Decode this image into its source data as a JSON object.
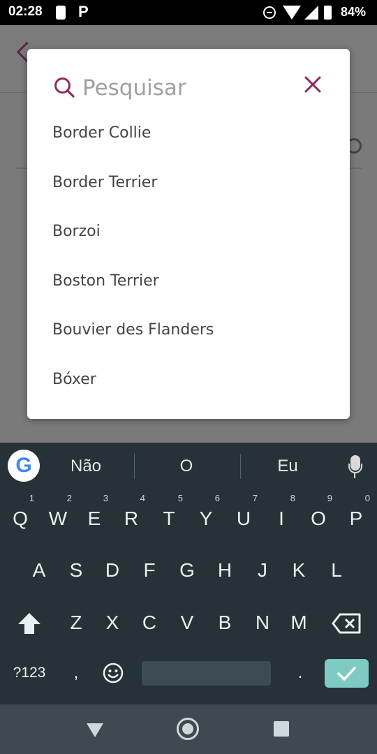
{
  "status_bar": {
    "time": "02:28",
    "battery": "84%"
  },
  "search": {
    "placeholder": "Pesquisar"
  },
  "breeds": [
    "Border Collie",
    "Border Terrier",
    "Borzoi",
    "Boston Terrier",
    "Bouvier des Flanders",
    "Bóxer"
  ],
  "suggestions": [
    "Não",
    "O",
    "Eu"
  ],
  "keys": {
    "row1": [
      "Q",
      "W",
      "E",
      "R",
      "T",
      "Y",
      "U",
      "I",
      "O",
      "P"
    ],
    "row1_hints": [
      "1",
      "2",
      "3",
      "4",
      "5",
      "6",
      "7",
      "8",
      "9",
      "0"
    ],
    "row2": [
      "A",
      "S",
      "D",
      "F",
      "G",
      "H",
      "J",
      "K",
      "L"
    ],
    "row3": [
      "Z",
      "X",
      "C",
      "V",
      "B",
      "N",
      "M"
    ],
    "symbols": "?123",
    "comma": ",",
    "period": "."
  },
  "colors": {
    "accent": "#8e2a63",
    "keyboard_bg": "#263238",
    "enter": "#7fcbc4"
  }
}
